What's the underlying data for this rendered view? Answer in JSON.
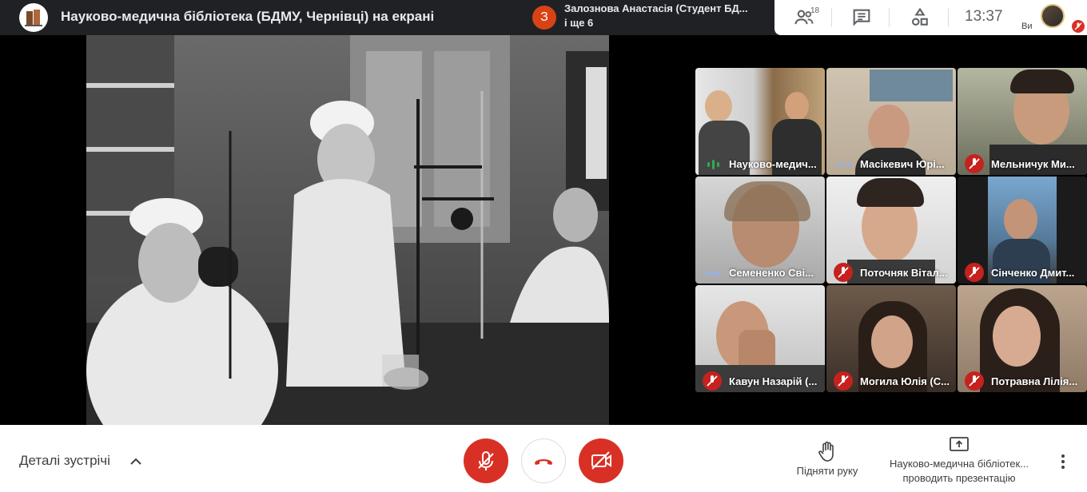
{
  "header": {
    "title": "Науково-медична бібліотека (БДМУ, Чернівці) на екрані",
    "logo_icon": "library-logo-icon"
  },
  "notification": {
    "badge": "З",
    "line1": "Залознова Анастасія (Студент БД...",
    "line2": "і ще 6"
  },
  "toolbar": {
    "people_count": "18",
    "time": "13:37",
    "self_label": "Ви"
  },
  "tiles": [
    {
      "name": "Науково-медич...",
      "state": "speaking"
    },
    {
      "name": "Масікевич Юрі...",
      "state": "dots"
    },
    {
      "name": "Мельничук Ми...",
      "state": "muted"
    },
    {
      "name": "Семененко Сві...",
      "state": "dots"
    },
    {
      "name": "Поточняк Вітал...",
      "state": "muted"
    },
    {
      "name": "Сінченко Дмит...",
      "state": "muted"
    },
    {
      "name": "Кавун Назарій (...",
      "state": "muted"
    },
    {
      "name": "Могила Юлія (С...",
      "state": "muted"
    },
    {
      "name": "Потравна Лілія...",
      "state": "muted"
    }
  ],
  "bottom": {
    "details_label": "Деталі зустрічі",
    "raise_hand_label": "Підняти руку",
    "presenter_line1": "Науково-медична бібліотек...",
    "presenter_line2": "проводить презентацію"
  },
  "colors": {
    "accent_red": "#d93025",
    "topbar": "#202124"
  }
}
